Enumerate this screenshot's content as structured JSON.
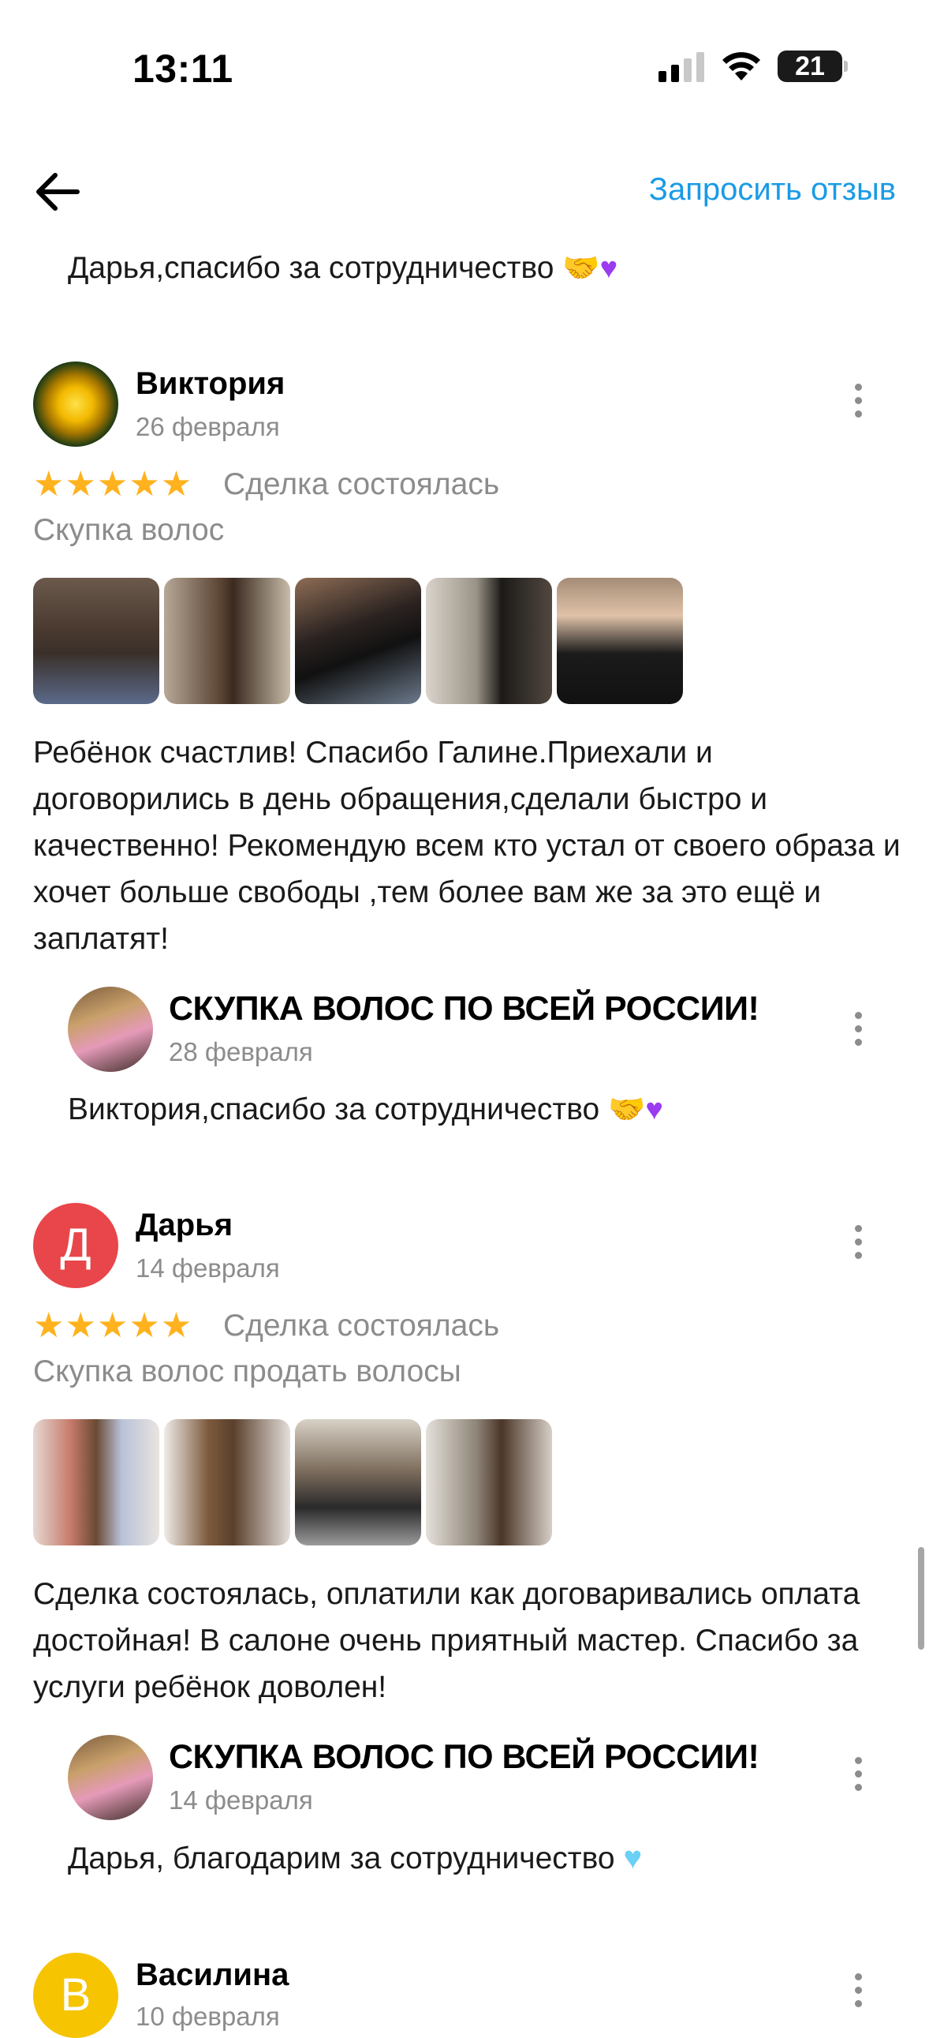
{
  "status_bar": {
    "time": "13:11",
    "battery": "21"
  },
  "header": {
    "request_review": "Запросить отзыв",
    "back_icon": "arrow-left-icon"
  },
  "top_reply": {
    "text": "Дарья,спасибо за сотрудничество"
  },
  "reviews": [
    {
      "name": "Виктория",
      "date": "26 февраля",
      "stars": 5,
      "status": "Сделка состоялась",
      "service": "Скупка волос",
      "text": "Ребёнок счастлив! Спасибо Галине.Приехали и договорились в день обращения,сделали быстро и качественно! Рекомендую всем кто устал от своего образа и хочет больше свободы ,тем более вам же за это ещё и заплатят!",
      "photo_count": 5,
      "reply": {
        "shop_name": "СКУПКА ВОЛОС ПО ВСЕЙ РОССИИ!",
        "date": "28 февраля",
        "text": "Виктория,спасибо за сотрудничество"
      }
    },
    {
      "name": "Дарья",
      "initial": "Д",
      "date": "14 февраля",
      "stars": 5,
      "status": "Сделка состоялась",
      "service": "Скупка волос продать волосы",
      "text": "Сделка состоялась, оплатили как договаривались оплата достойная! В салоне очень приятный мастер. Спасибо за услуги ребёнок доволен!",
      "photo_count": 4,
      "reply": {
        "shop_name": "СКУПКА ВОЛОС ПО ВСЕЙ РОССИИ!",
        "date": "14 февраля",
        "text": "Дарья, благодарим за сотрудничество"
      }
    },
    {
      "name": "Василина",
      "initial": "В",
      "date": "10 февраля"
    }
  ],
  "colors": {
    "accent": "#1a9be6",
    "star": "#ffb21e",
    "avatar_red": "#e8464a",
    "avatar_yellow": "#f6c400"
  }
}
